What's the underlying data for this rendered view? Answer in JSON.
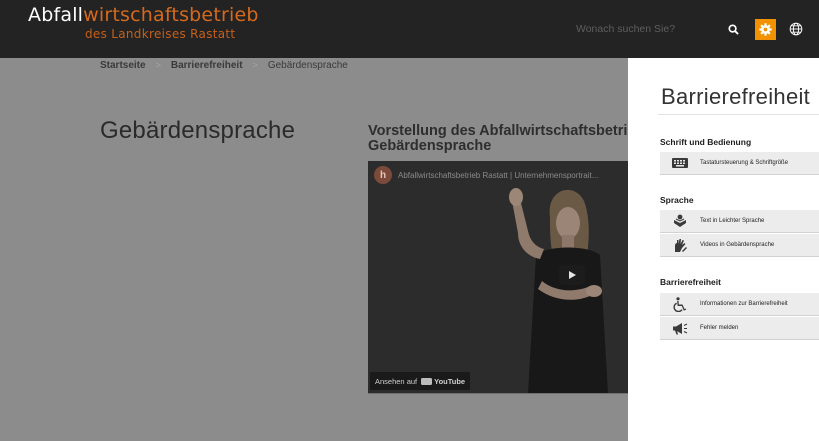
{
  "header": {
    "logo": {
      "prefix": "Abfall",
      "accent": "wirtschaftsbetrieb",
      "subtitle": "des Landkreises Rastatt"
    },
    "search_placeholder": "Wonach suchen Sie?",
    "icons": {
      "search": "search-icon",
      "settings": "gear-icon",
      "language": "globe-icon"
    },
    "accent_color": "#f39200"
  },
  "breadcrumb": {
    "items": [
      {
        "label": "Startseite"
      },
      {
        "label": "Barrierefreiheit"
      },
      {
        "label": "Gebärdensprache"
      }
    ],
    "separator": ">"
  },
  "page": {
    "title": "Gebärdensprache",
    "video": {
      "heading_line1": "Vorstellung des Abfallwirtschaftsbetriebs de",
      "heading_line2": "Gebärdensprache",
      "channel_letter": "h",
      "channel_title": "Abfallwirtschaftsbetrieb Rastatt | Unternehmensportrait...",
      "watch_on": "Ansehen auf",
      "platform": "YouTube"
    }
  },
  "accessibility_panel": {
    "title": "Barrierefreiheit",
    "sections": [
      {
        "title": "Schrift und Bedienung",
        "items": [
          {
            "label": "Tastatursteuerung & Schriftgröße",
            "icon": "keyboard-icon"
          }
        ]
      },
      {
        "title": "Sprache",
        "items": [
          {
            "label": "Text in Leichter Sprache",
            "icon": "easy-language-icon"
          },
          {
            "label": "Videos in Gebärdensprache",
            "icon": "sign-language-icon"
          }
        ]
      },
      {
        "title": "Barrierefreiheit",
        "items": [
          {
            "label": "Informationen zur Barrierefreiheit",
            "icon": "wheelchair-icon"
          },
          {
            "label": "Fehler melden",
            "icon": "megaphone-icon"
          }
        ]
      }
    ]
  }
}
